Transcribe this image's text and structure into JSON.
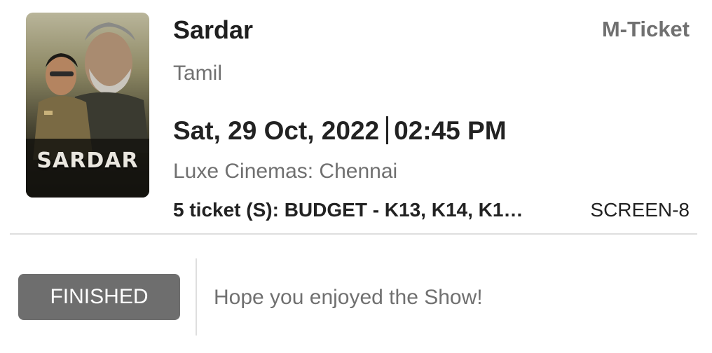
{
  "booking": {
    "poster_text": "SARDAR",
    "movie_title": "Sardar",
    "ticket_type": "M-Ticket",
    "language": "Tamil",
    "date": "Sat, 29 Oct, 2022",
    "time": "02:45 PM",
    "venue": "Luxe Cinemas: Chennai",
    "tickets": "5 ticket (S): BUDGET - K13, K14, K1…",
    "screen": "SCREEN-8"
  },
  "status": {
    "badge": "FINISHED",
    "message": "Hope you enjoyed the Show!"
  },
  "colors": {
    "badge_bg": "#6e6e6e",
    "muted_text": "#707070",
    "divider": "#dedede"
  }
}
